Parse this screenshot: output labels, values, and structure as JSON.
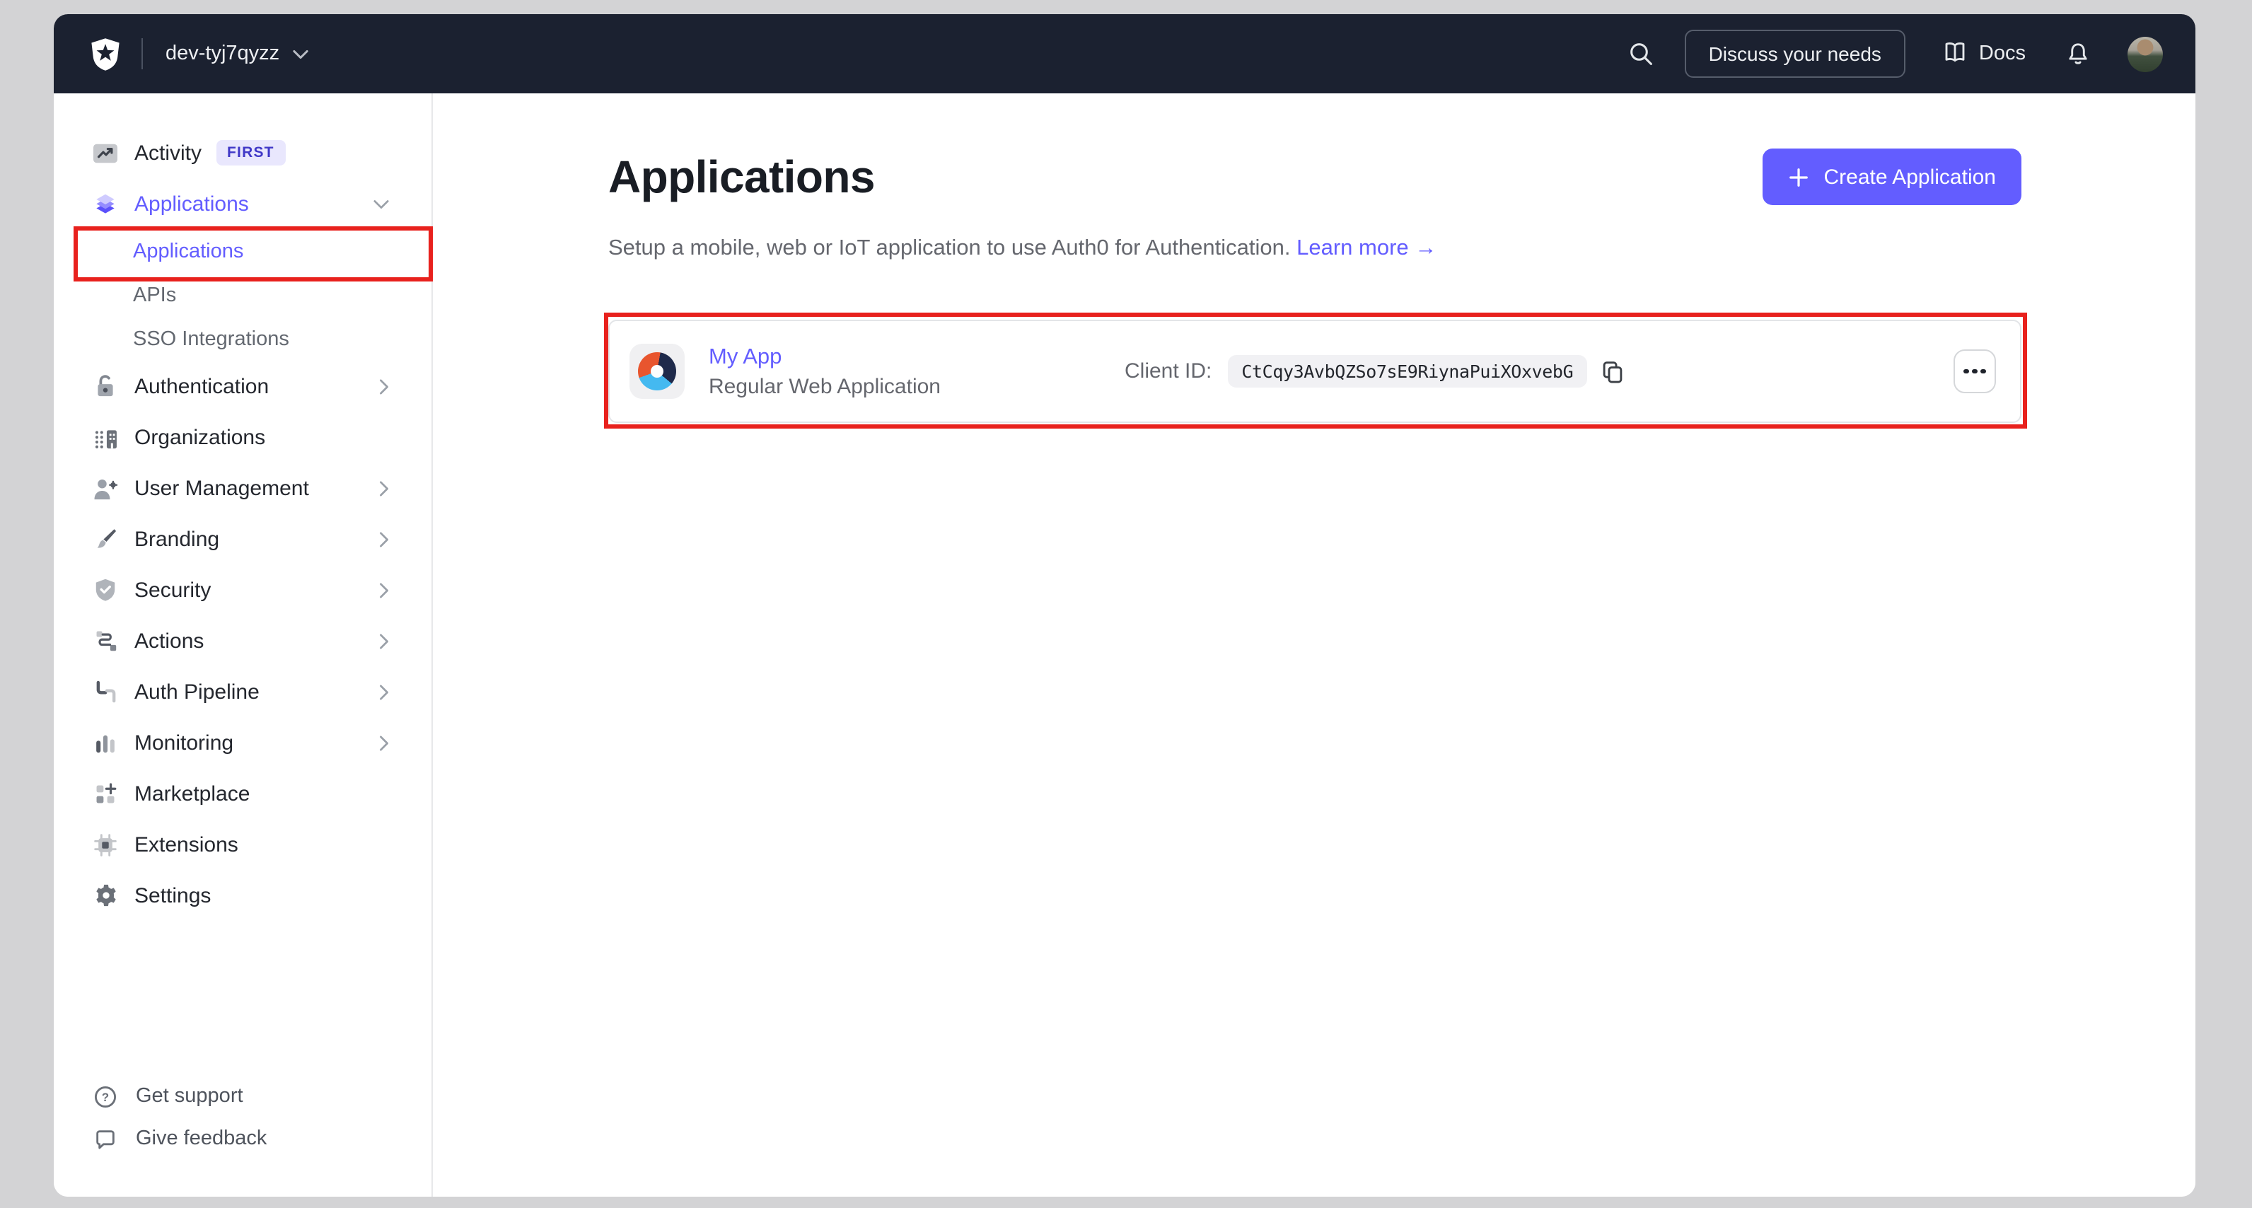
{
  "topbar": {
    "tenant": "dev-tyj7qyzz",
    "discuss_button": "Discuss your needs",
    "docs_label": "Docs"
  },
  "sidebar": {
    "items": [
      {
        "label": "Activity",
        "badge": "FIRST"
      },
      {
        "label": "Applications"
      },
      {
        "label": "Authentication"
      },
      {
        "label": "Organizations"
      },
      {
        "label": "User Management"
      },
      {
        "label": "Branding"
      },
      {
        "label": "Security"
      },
      {
        "label": "Actions"
      },
      {
        "label": "Auth Pipeline"
      },
      {
        "label": "Monitoring"
      },
      {
        "label": "Marketplace"
      },
      {
        "label": "Extensions"
      },
      {
        "label": "Settings"
      }
    ],
    "sub_items": [
      {
        "label": "Applications"
      },
      {
        "label": "APIs"
      },
      {
        "label": "SSO Integrations"
      }
    ],
    "footer": [
      {
        "label": "Get support"
      },
      {
        "label": "Give feedback"
      }
    ]
  },
  "main": {
    "title": "Applications",
    "subtitle": "Setup a mobile, web or IoT application to use Auth0 for Authentication.",
    "learn_more": "Learn more",
    "learn_more_arrow": "→",
    "create_button": "Create Application",
    "application": {
      "name": "My App",
      "type": "Regular Web Application",
      "client_id_label": "Client ID:",
      "client_id": "CtCqy3AvbQZSo7sE9RiynaPuiXOxvebG"
    }
  },
  "colors": {
    "accent": "#635dff",
    "topbar_bg": "#1b2130",
    "annotation_red": "#e8211d",
    "badge_bg": "#e9e7fd",
    "badge_text": "#4038c7",
    "app_logo_orange": "#e8552e",
    "app_logo_navy": "#1f2a4b",
    "app_logo_blue": "#44b9f0"
  }
}
